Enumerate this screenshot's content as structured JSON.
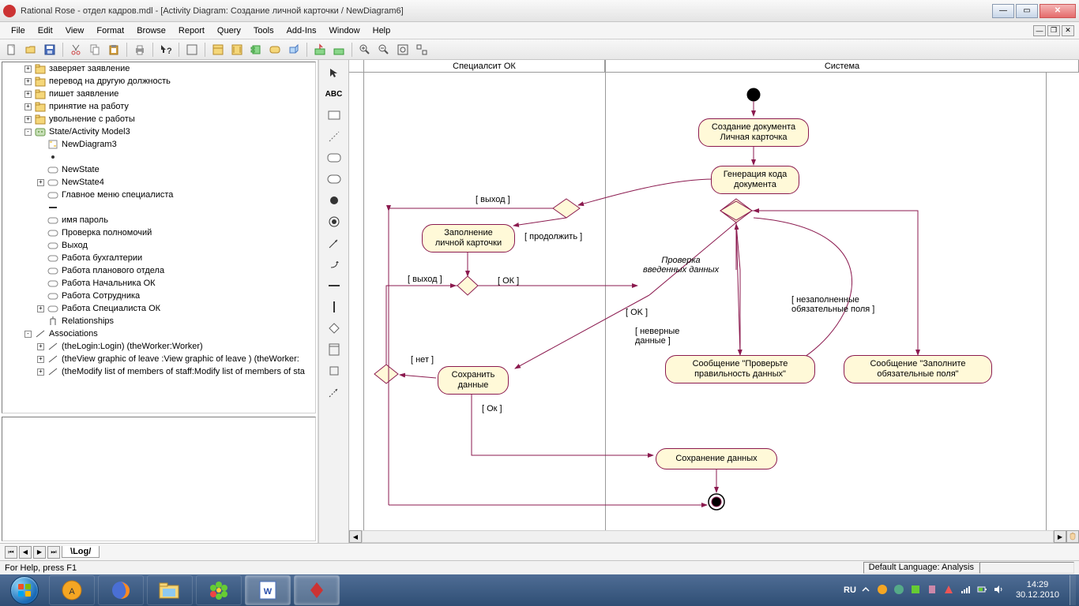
{
  "window": {
    "title": "Rational Rose - отдел кадров.mdl - [Activity Diagram: Создание личной карточки / NewDiagram6]"
  },
  "menu": {
    "items": [
      "File",
      "Edit",
      "View",
      "Format",
      "Browse",
      "Report",
      "Query",
      "Tools",
      "Add-Ins",
      "Window",
      "Help"
    ]
  },
  "palette": {
    "text_tool": "ABC"
  },
  "tree": {
    "items": [
      {
        "indent": 1,
        "exp": "+",
        "icon": "package",
        "label": "заверяет заявление"
      },
      {
        "indent": 1,
        "exp": "+",
        "icon": "package",
        "label": "перевод на другую должность"
      },
      {
        "indent": 1,
        "exp": "+",
        "icon": "package",
        "label": "пишет заявление"
      },
      {
        "indent": 1,
        "exp": "+",
        "icon": "package",
        "label": "принятие на работу"
      },
      {
        "indent": 1,
        "exp": "+",
        "icon": "package",
        "label": "увольнение с работы"
      },
      {
        "indent": 1,
        "exp": "-",
        "icon": "model",
        "label": "State/Activity Model3"
      },
      {
        "indent": 2,
        "exp": "",
        "icon": "diagram",
        "label": "NewDiagram3"
      },
      {
        "indent": 2,
        "exp": "",
        "icon": "dot",
        "label": ""
      },
      {
        "indent": 2,
        "exp": "",
        "icon": "state",
        "label": "NewState"
      },
      {
        "indent": 2,
        "exp": "+",
        "icon": "state",
        "label": "NewState4"
      },
      {
        "indent": 2,
        "exp": "",
        "icon": "state",
        "label": "Главное меню специалиста"
      },
      {
        "indent": 2,
        "exp": "",
        "icon": "bar",
        "label": ""
      },
      {
        "indent": 2,
        "exp": "",
        "icon": "state",
        "label": "имя пароль"
      },
      {
        "indent": 2,
        "exp": "",
        "icon": "activity",
        "label": "Проверка полномочий"
      },
      {
        "indent": 2,
        "exp": "",
        "icon": "activity",
        "label": "Выход"
      },
      {
        "indent": 2,
        "exp": "",
        "icon": "activity",
        "label": "Работа  бухгалтерии"
      },
      {
        "indent": 2,
        "exp": "",
        "icon": "activity",
        "label": "Работа  планового отдела"
      },
      {
        "indent": 2,
        "exp": "",
        "icon": "activity",
        "label": "Работа Начальника ОК"
      },
      {
        "indent": 2,
        "exp": "",
        "icon": "activity",
        "label": "Работа Сотрудника"
      },
      {
        "indent": 2,
        "exp": "+",
        "icon": "activity",
        "label": "Работа Специалиста ОК"
      },
      {
        "indent": 2,
        "exp": "",
        "icon": "rel",
        "label": "Relationships"
      },
      {
        "indent": 1,
        "exp": "-",
        "icon": "assoc",
        "label": "Associations"
      },
      {
        "indent": 2,
        "exp": "+",
        "icon": "link",
        "label": "(theLogin:Login) (theWorker:Worker)"
      },
      {
        "indent": 2,
        "exp": "+",
        "icon": "link",
        "label": "(theView graphic of leave :View graphic of leave ) (theWorker:"
      },
      {
        "indent": 2,
        "exp": "+",
        "icon": "link",
        "label": "(theModify list of members of staff:Modify list of members of sta"
      }
    ]
  },
  "diagram": {
    "lanes": [
      "Специалсит ОК",
      "Система"
    ],
    "nodes": {
      "n1": "Создание документа\nЛичная карточка",
      "n2": "Генерация кода\nдокумента",
      "n3": "Заполнение\nличной карточки",
      "n4": "Сохранить\nданные",
      "n5": "Сообщение \"Проверьте\nправильность данных\"",
      "n6": "Сообщение \"Заполните\nобязательные поля\"",
      "n7": "Сохранение данных"
    },
    "labels": {
      "l_exit1": "[ выход ]",
      "l_cont": "[ продолжить ]",
      "l_exit2": "[ выход ]",
      "l_ok1": "[ ОК ]",
      "l_check": "Проверка\nвведенных данных",
      "l_ok2": "[ OK ]",
      "l_unfilled": "[ незаполненные\nобязательные поля ]",
      "l_wrong": "[ неверные\nданные ]",
      "l_no": "[ нет ]",
      "l_ok3": "[ Ок ]"
    }
  },
  "log": {
    "tab": "Log"
  },
  "status": {
    "help": "For Help, press F1",
    "lang": "Default Language: Analysis"
  },
  "taskbar": {
    "lang_ind": "RU",
    "time": "14:29",
    "date": "30.12.2010"
  }
}
